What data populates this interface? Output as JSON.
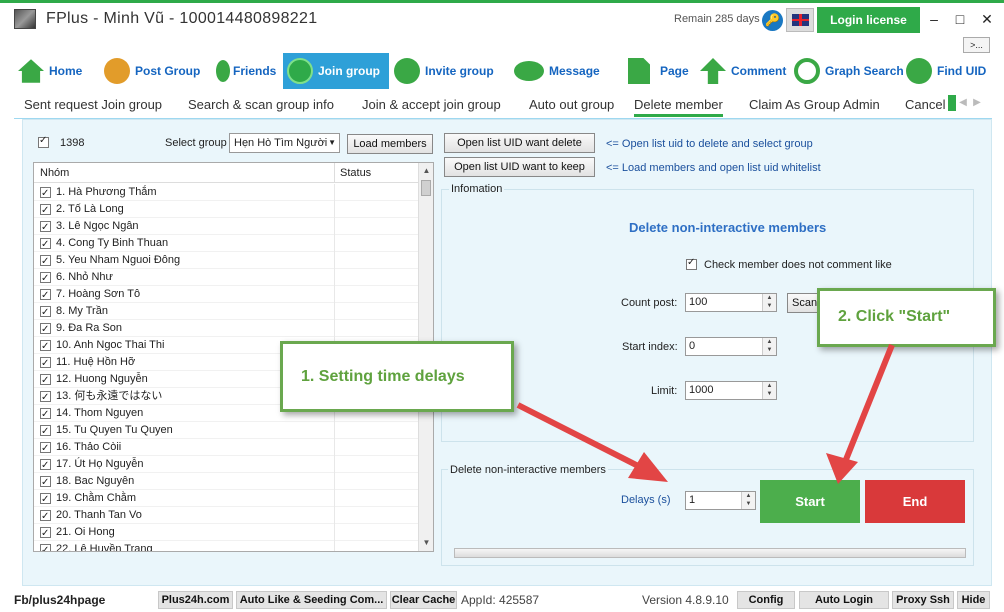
{
  "window": {
    "title": "FPlus - Minh Vũ - 100014480898221",
    "remain": "Remain 285 days",
    "login_label": "Login license",
    "minimize": "–",
    "maximize": "□",
    "close": "✕",
    "more_label": ">..."
  },
  "toolbar": {
    "items": [
      {
        "label": "Home",
        "icon": "home-icon"
      },
      {
        "label": "Post Group",
        "icon": "people-icon"
      },
      {
        "label": "Friends",
        "icon": "friends-icon"
      },
      {
        "label": "Join group",
        "icon": "join-group-icon",
        "active": true
      },
      {
        "label": "Invite group",
        "icon": "add-user-icon"
      },
      {
        "label": "Message",
        "icon": "chat-icon"
      },
      {
        "label": "Page",
        "icon": "page-icon"
      },
      {
        "label": "Comment",
        "icon": "arrow-up-icon"
      },
      {
        "label": "Graph Search",
        "icon": "search-icon"
      },
      {
        "label": "Find UID",
        "icon": "find-user-icon"
      }
    ]
  },
  "subtabs": [
    "Sent request Join group",
    "Search & scan group info",
    "Join & accept join group",
    "Auto out group",
    "Delete member",
    "Claim As Group Admin",
    "Cancel"
  ],
  "left": {
    "count": "1398",
    "select_label": "Select group",
    "select_value": "Hẹn Hò Tìm Người",
    "load_members": "Load members",
    "col_name": "Nhóm",
    "col_status": "Status",
    "rows": [
      "1. Hà Phương Thắm",
      "2. Tố Là Long",
      "3. Lê Ngọc Ngân",
      "4. Cong Ty Binh Thuan",
      "5. Yeu Nham Nguoi Đông",
      "6. Nhỏ Như",
      "7. Hoàng Sơn Tô",
      "8. My Trần",
      "9. Đa Ra Son",
      "10. Anh Ngoc Thai Thi",
      "11. Huệ Hồn Hỡ",
      "12. Huong Nguyễn",
      "13. 何も永遠ではない",
      "14. Thom Nguyen",
      "15. Tu Quyen Tu Quyen",
      "16. Thảo Còii",
      "17. Út Họ Nguyễn",
      "18. Bac Nguyên",
      "19. Chằm Chằm",
      "20. Thanh Tan Vo",
      "21. Oi Hong",
      "22. Lê Huyền Trang"
    ]
  },
  "right": {
    "open_delete": "Open list UID want delete",
    "open_delete_hint": "<= Open list uid to delete and select group",
    "open_keep": "Open list UID want to keep",
    "open_keep_hint": "<= Load members and open list uid whitelist",
    "info_title": "Infomation",
    "heading": "Delete non-interactive members",
    "check_label": "Check member does not comment like",
    "count_post_label": "Count post:",
    "count_post": "100",
    "scan_label": "Scan",
    "start_index_label": "Start index:",
    "start_index": "0",
    "limit_label": "Limit:",
    "limit": "1000",
    "group2_title": "Delete non-interactive members",
    "delays_label": "Delays (s)",
    "delays": "1",
    "start": "Start",
    "end": "End"
  },
  "callouts": {
    "one": "1. Setting time delays",
    "two": "2. Click \"Start\""
  },
  "status": {
    "fb": "Fb/plus24hpage",
    "plus24h": "Plus24h.com",
    "auto_like": "Auto Like & Seeding Com...",
    "clear_cache": "Clear Cache",
    "appid": "AppId: 425587",
    "version": "Version 4.8.9.10",
    "config": "Config",
    "auto_login": "Auto Login",
    "proxy_ssh": "Proxy Ssh",
    "hide": "Hide"
  },
  "colors": {
    "brand_green": "#2faa49",
    "link_blue": "#1565c0",
    "active_tab": "#2ea0d8",
    "start": "#4cae4c",
    "end": "#d9393a",
    "callout": "#6aa84f",
    "arrow": "#e24545"
  }
}
